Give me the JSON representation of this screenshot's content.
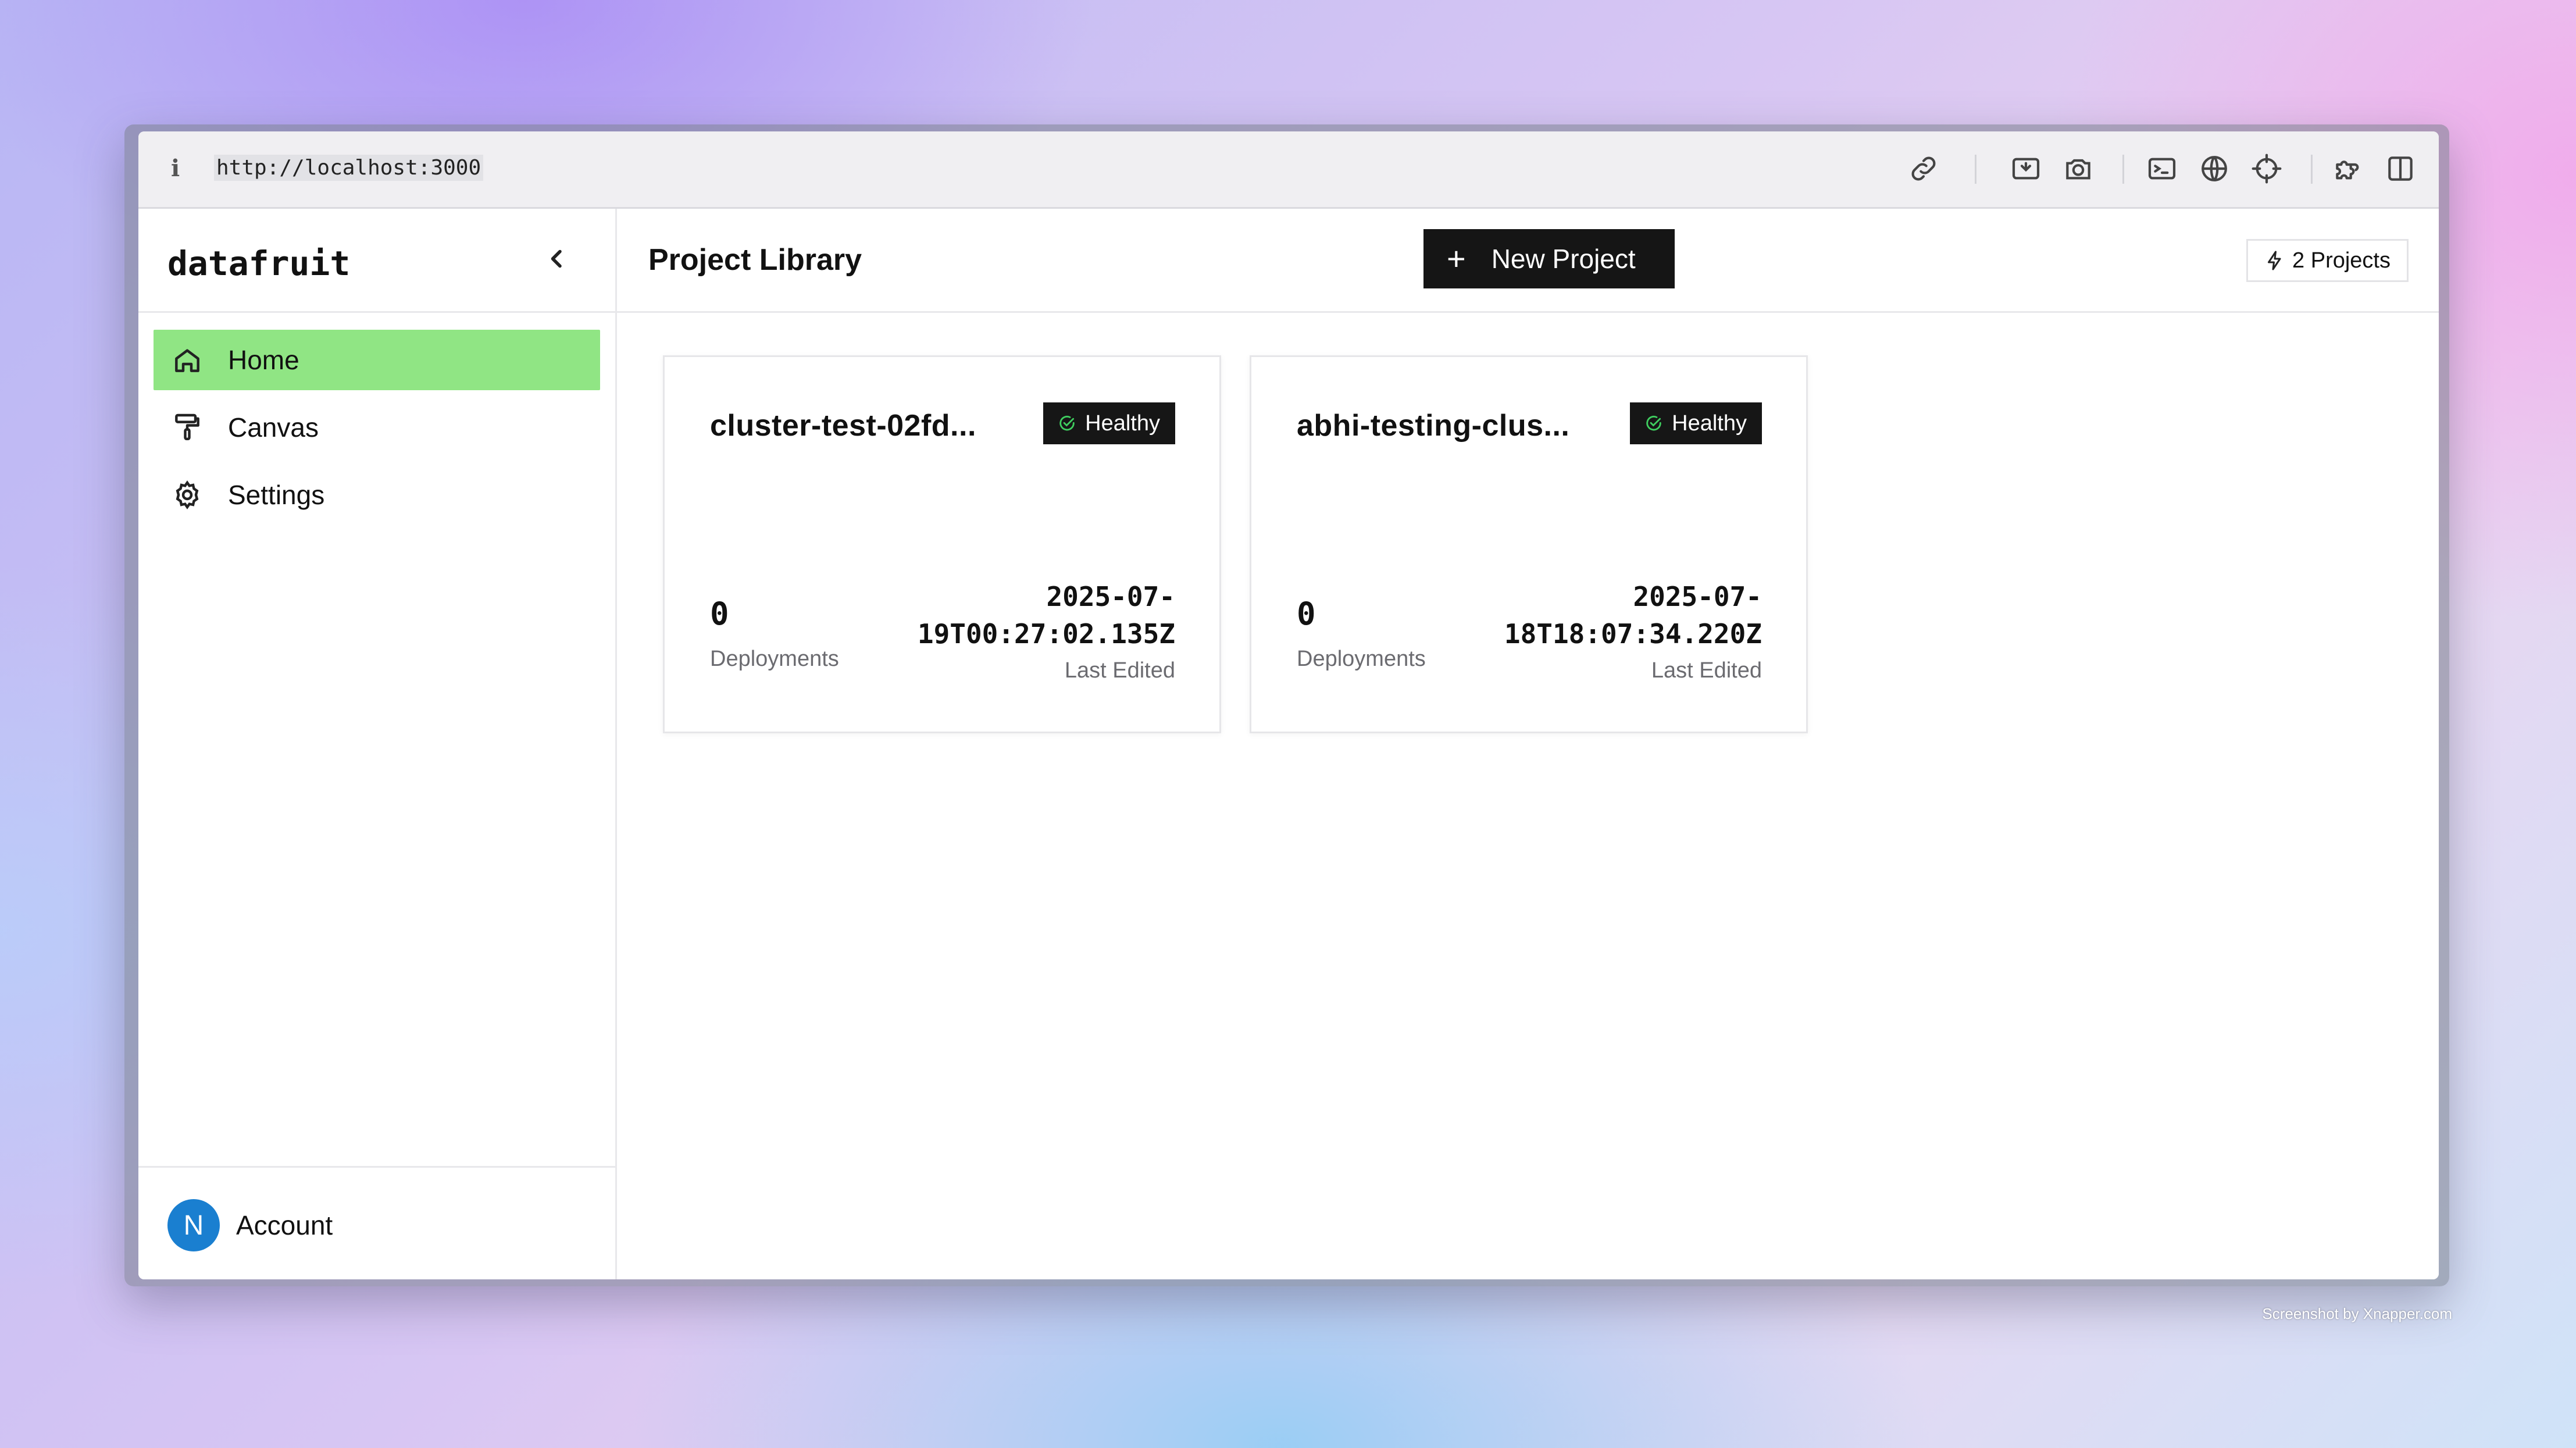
{
  "browser": {
    "info_glyph": "i",
    "url": "http://localhost:3000",
    "toolbar_icons": [
      "link-icon",
      "screen-capture-icon",
      "camera-icon",
      "terminal-icon",
      "globe-icon",
      "crosshair-icon",
      "extensions-icon",
      "split-view-icon"
    ]
  },
  "sidebar": {
    "brand": "datafruit",
    "items": [
      {
        "label": "Home",
        "icon": "home-icon",
        "active": true
      },
      {
        "label": "Canvas",
        "icon": "paint-roller-icon",
        "active": false
      },
      {
        "label": "Settings",
        "icon": "gear-icon",
        "active": false
      }
    ],
    "account": {
      "initial": "N",
      "label": "Account"
    }
  },
  "header": {
    "title": "Project Library",
    "new_project_label": "New Project",
    "project_count": "2 Projects"
  },
  "projects": [
    {
      "name": "cluster-test-02fd...",
      "status": "Healthy",
      "deployments": "0",
      "deployments_label": "Deployments",
      "last_edited_line1": "2025-07-",
      "last_edited_line2": "19T00:27:02.135Z",
      "last_edited_label": "Last Edited"
    },
    {
      "name": "abhi-testing-clus...",
      "status": "Healthy",
      "deployments": "0",
      "deployments_label": "Deployments",
      "last_edited_line1": "2025-07-",
      "last_edited_line2": "18T18:07:34.220Z",
      "last_edited_label": "Last Edited"
    }
  ],
  "colors": {
    "active_nav": "#90e584",
    "avatar": "#1a7fd0",
    "badge_bg": "#161616",
    "healthy_check": "#3fce5f"
  },
  "watermark": "Screenshot by Xnapper.com"
}
